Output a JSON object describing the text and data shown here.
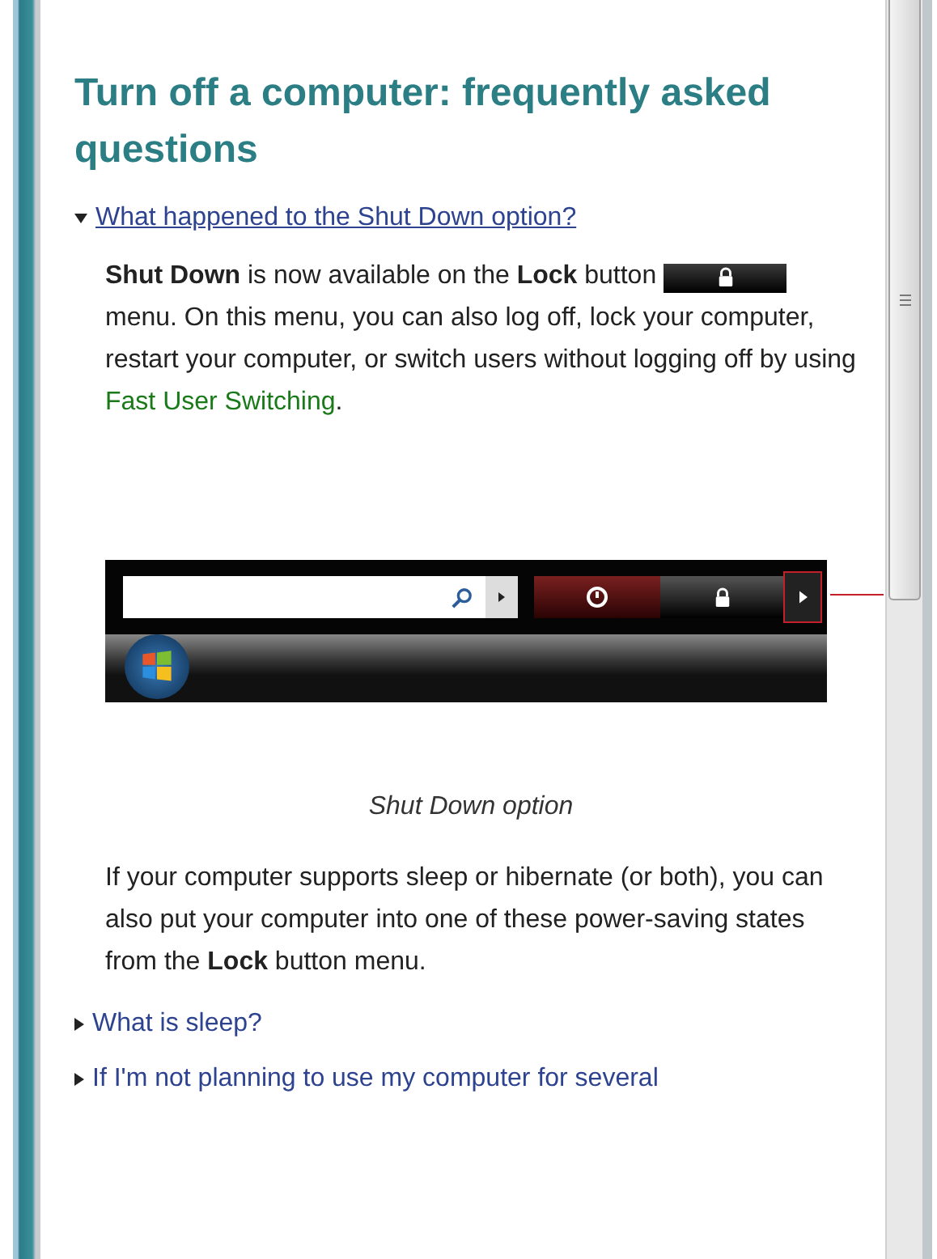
{
  "heading": "Turn off a computer: frequently asked questions",
  "sections": [
    {
      "title": "What happened to the Shut Down option?",
      "expanded": true,
      "body": {
        "before": "**Shut Down** is now available on the **Lock** button",
        "after": "menu. On this menu, you can also log off, lock your computer, restart your computer, or switch users without logging off by using",
        "link": "Fast User Switching",
        "end": "."
      },
      "caption": "Shut Down option",
      "note": "If your computer supports sleep or hibernate (or both), you can also put your computer into one of these power-saving states from the **Lock** button menu."
    },
    {
      "title": "What is sleep?",
      "expanded": false
    },
    {
      "title": "If I'm not planning to use my computer for several",
      "expanded": false
    }
  ]
}
